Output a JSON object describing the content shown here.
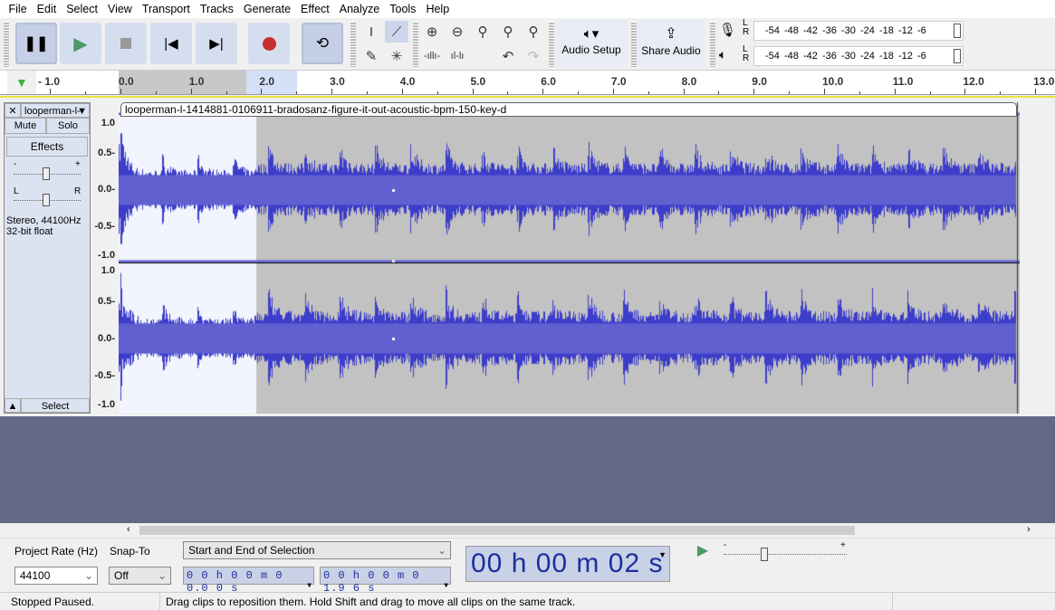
{
  "menu": [
    "File",
    "Edit",
    "Select",
    "View",
    "Transport",
    "Tracks",
    "Generate",
    "Effect",
    "Analyze",
    "Tools",
    "Help"
  ],
  "transport": {
    "pause": "pause-icon",
    "play": "play-icon",
    "stop": "stop-icon",
    "skip_start": "skip-start-icon",
    "skip_end": "skip-end-icon",
    "record": "record-icon",
    "loop": "loop-icon"
  },
  "audio_setup": "Audio Setup",
  "share_audio": "Share Audio",
  "meter_ticks": [
    "-54",
    "-48",
    "-42",
    "-36",
    "-30",
    "-24",
    "-18",
    "-12",
    "-6"
  ],
  "ruler": {
    "labels": [
      "- 1.0",
      "0.0",
      "1.0",
      "2.0",
      "3.0",
      "4.0",
      "5.0",
      "6.0",
      "7.0",
      "8.0",
      "9.0",
      "10.0",
      "11.0",
      "12.0",
      "13.0"
    ]
  },
  "track": {
    "name": "looperman-l-",
    "clip_title": "looperman-l-1414881-0106911-bradosanz-figure-it-out-acoustic-bpm-150-key-d",
    "mute": "Mute",
    "solo": "Solo",
    "effects": "Effects",
    "gain_minus": "-",
    "gain_plus": "+",
    "pan_l": "L",
    "pan_r": "R",
    "info1": "Stereo, 44100Hz",
    "info2": "32-bit float",
    "select": "Select",
    "close": "✕",
    "collapse": "▲",
    "scale": [
      "1.0",
      "0.5-",
      "0.0-",
      "-0.5-",
      "-1.0"
    ]
  },
  "bottom": {
    "project_rate_label": "Project Rate (Hz)",
    "project_rate": "44100",
    "snap_label": "Snap-To",
    "snap": "Off",
    "selection_mode": "Start and End of Selection",
    "start": "0 0 h 0 0 m 0 0.0 0 s",
    "end": "0 0 h 0 0 m 0 1.9 6 s",
    "time": "00 h 00 m 02 s",
    "play_speed_minus": "-",
    "play_speed_plus": "+"
  },
  "status": {
    "state": "Stopped Paused.",
    "hint": "Drag clips to reposition them. Hold Shift and drag to move all clips on the same track."
  },
  "colors": {
    "wave": "#3d3dcb",
    "selection": "#c2c2c2",
    "background": "#616987",
    "accent_green": "#4a9a6a",
    "record": "#c43030"
  }
}
